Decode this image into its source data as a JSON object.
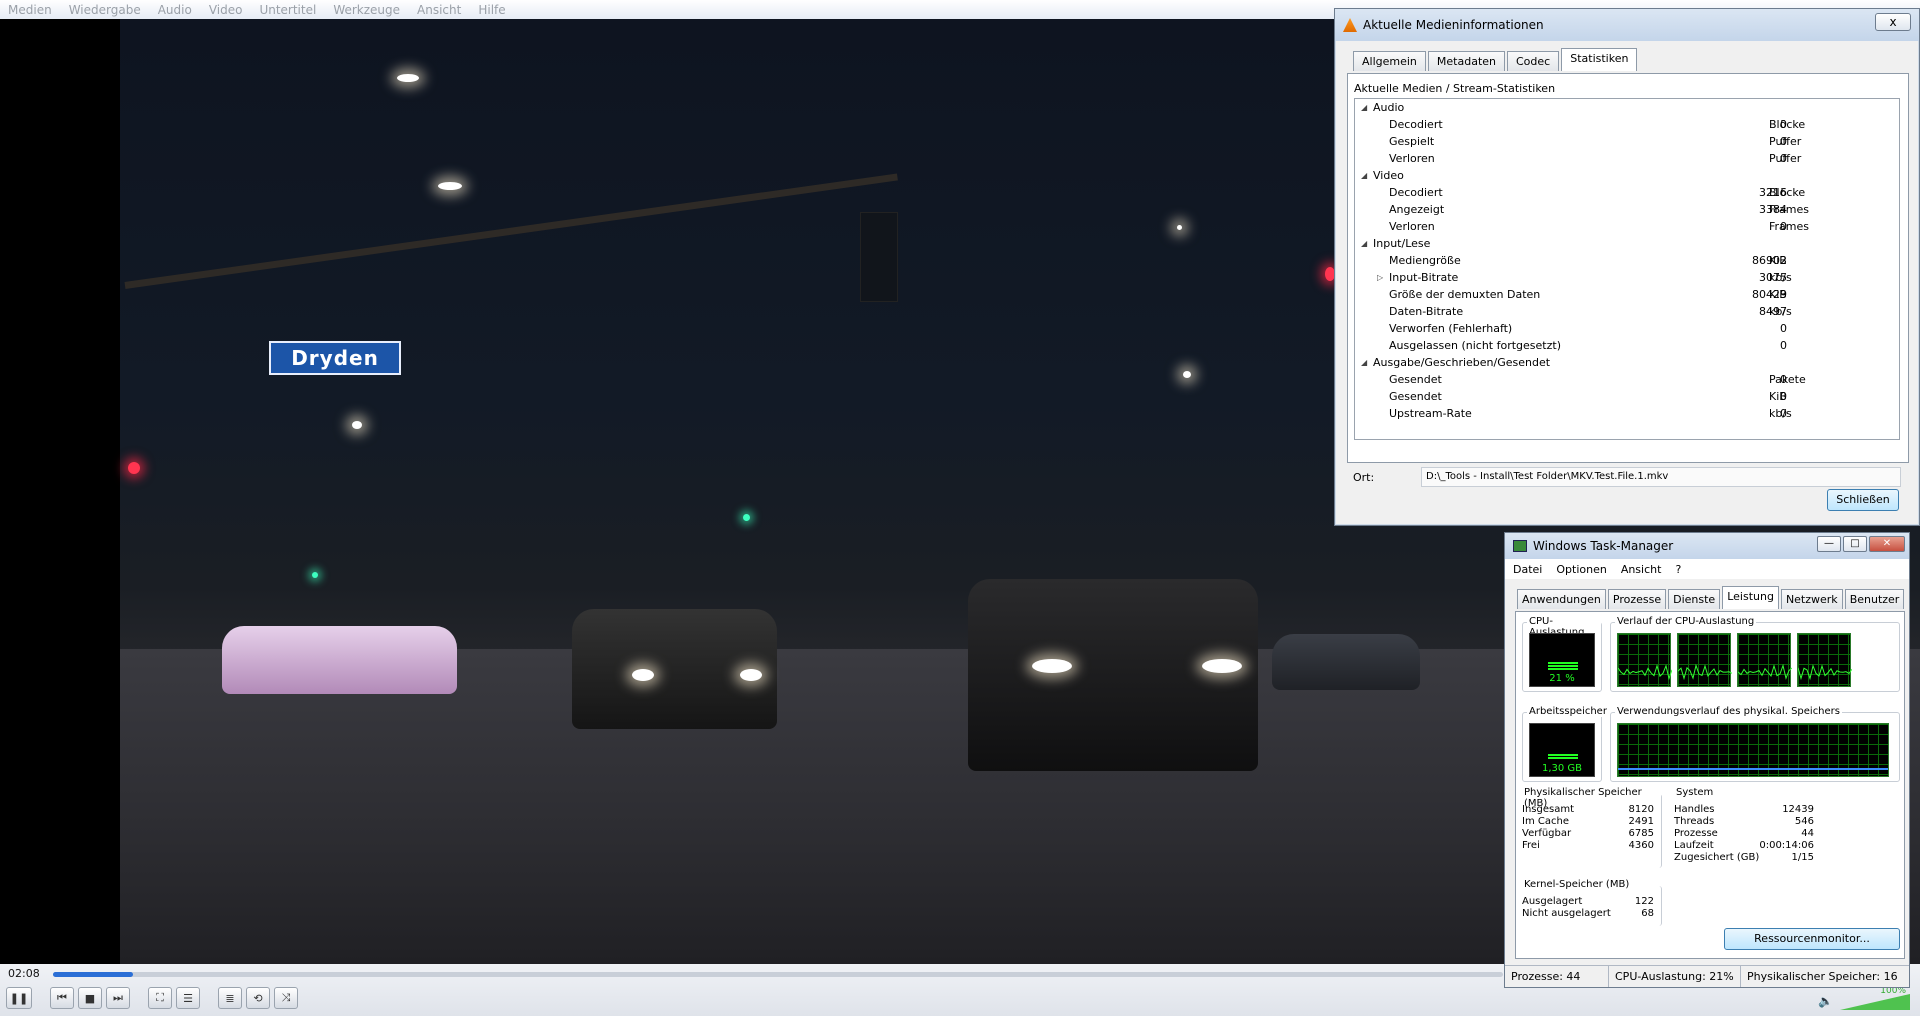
{
  "vlc": {
    "menu": [
      "Medien",
      "Wiedergabe",
      "Audio",
      "Video",
      "Untertitel",
      "Werkzeuge",
      "Ansicht",
      "Hilfe"
    ],
    "time_elapsed": "02:08",
    "seek_progress": 0.055,
    "volume_percent": "100%"
  },
  "video": {
    "street_sign": "Dryden"
  },
  "media_info": {
    "title": "Aktuelle Medieninformationen",
    "close_x": "x",
    "tabs": [
      "Allgemein",
      "Metadaten",
      "Codec",
      "Statistiken"
    ],
    "active_tab": "Statistiken",
    "heading": "Aktuelle Medien / Stream-Statistiken",
    "rows": [
      {
        "label": "Audio",
        "value": "",
        "unit": "",
        "level": 0,
        "expand": "◢"
      },
      {
        "label": "Decodiert",
        "value": "0",
        "unit": "Blöcke",
        "level": 1
      },
      {
        "label": "Gespielt",
        "value": "0",
        "unit": "Puffer",
        "level": 1
      },
      {
        "label": "Verloren",
        "value": "0",
        "unit": "Puffer",
        "level": 1
      },
      {
        "label": "Video",
        "value": "",
        "unit": "",
        "level": 0,
        "expand": "◢"
      },
      {
        "label": "Decodiert",
        "value": "3216",
        "unit": "Blöcke",
        "level": 1
      },
      {
        "label": "Angezeigt",
        "value": "3384",
        "unit": "Frames",
        "level": 1
      },
      {
        "label": "Verloren",
        "value": "0",
        "unit": "Frames",
        "level": 1
      },
      {
        "label": "Input/Lese",
        "value": "",
        "unit": "",
        "level": 0,
        "expand": "◢"
      },
      {
        "label": "Mediengröße",
        "value": "86902",
        "unit": "KiB",
        "level": 1
      },
      {
        "label": "Input-Bitrate",
        "value": "3075",
        "unit": "kb/s",
        "level": 1,
        "expand": "▷"
      },
      {
        "label": "Größe der demuxten Daten",
        "value": "80429",
        "unit": "KiB",
        "level": 1
      },
      {
        "label": "Daten-Bitrate",
        "value": "8497",
        "unit": "kb/s",
        "level": 1
      },
      {
        "label": "Verworfen (Fehlerhaft)",
        "value": "0",
        "unit": "",
        "level": 1
      },
      {
        "label": "Ausgelassen (nicht fortgesetzt)",
        "value": "0",
        "unit": "",
        "level": 1
      },
      {
        "label": "Ausgabe/Geschrieben/Gesendet",
        "value": "",
        "unit": "",
        "level": 0,
        "expand": "◢"
      },
      {
        "label": "Gesendet",
        "value": "0",
        "unit": "Pakete",
        "level": 1
      },
      {
        "label": "Gesendet",
        "value": "0",
        "unit": "KiB",
        "level": 1
      },
      {
        "label": "Upstream-Rate",
        "value": "0",
        "unit": "kb/s",
        "level": 1
      }
    ],
    "ort_label": "Ort:",
    "ort_value": "D:\\_Tools - Install\\Test Folder\\MKV.Test.File.1.mkv",
    "close_button": "Schließen"
  },
  "task_manager": {
    "title": "Windows Task-Manager",
    "window_buttons": [
      "—",
      "□",
      "✕"
    ],
    "menu": [
      "Datei",
      "Optionen",
      "Ansicht",
      "?"
    ],
    "tabs": [
      "Anwendungen",
      "Prozesse",
      "Dienste",
      "Leistung",
      "Netzwerk",
      "Benutzer"
    ],
    "active_tab": "Leistung",
    "cpu_label": "CPU-Auslastung",
    "cpu_value": "21 %",
    "cpu_fraction": 0.21,
    "cpu_history_label": "Verlauf der CPU-Auslastung",
    "mem_label": "Arbeitsspeicher",
    "mem_value": "1,30 GB",
    "mem_fraction": 0.16,
    "mem_history_label": "Verwendungsverlauf des physikal. Speichers",
    "phys": {
      "title": "Physikalischer Speicher (MB)",
      "rows": [
        [
          "Insgesamt",
          "8120"
        ],
        [
          "Im Cache",
          "2491"
        ],
        [
          "Verfügbar",
          "6785"
        ],
        [
          "Frei",
          "4360"
        ]
      ]
    },
    "kernel": {
      "title": "Kernel-Speicher (MB)",
      "rows": [
        [
          "Ausgelagert",
          "122"
        ],
        [
          "Nicht ausgelagert",
          "68"
        ]
      ]
    },
    "system": {
      "title": "System",
      "rows": [
        [
          "Handles",
          "12439"
        ],
        [
          "Threads",
          "546"
        ],
        [
          "Prozesse",
          "44"
        ],
        [
          "Laufzeit",
          "0:00:14:06"
        ],
        [
          "Zugesichert (GB)",
          "1/15"
        ]
      ]
    },
    "resmon_button": "Ressourcenmonitor...",
    "status": [
      "Prozesse: 44",
      "CPU-Auslastung: 21%",
      "Physikalischer Speicher: 16"
    ]
  }
}
